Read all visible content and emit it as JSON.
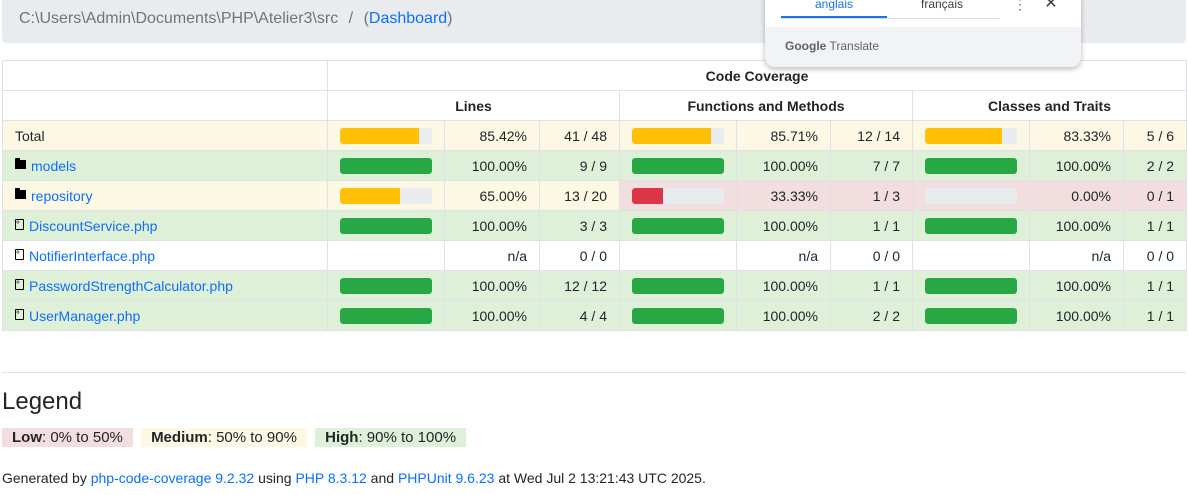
{
  "breadcrumb": {
    "path": "C:\\Users\\Admin\\Documents\\PHP\\Atelier3\\src",
    "separator": "/",
    "open_paren": "(",
    "dashboard_label": "Dashboard",
    "close_paren": ")"
  },
  "translate_popup": {
    "tab_active": "anglais",
    "tab_other": "français",
    "more": "⋮",
    "close": "✕",
    "brand_google": "Google",
    "brand_translate": "Translate"
  },
  "table": {
    "header_main": "Code Coverage",
    "group_lines": "Lines",
    "group_functions": "Functions and Methods",
    "group_classes": "Classes and Traits",
    "rows": [
      {
        "name": "Total",
        "kind": "total",
        "lines_pct": "85.42%",
        "lines_frac": "41 / 48",
        "lines_bar": 85.42,
        "func_pct": "85.71%",
        "func_frac": "12 / 14",
        "func_bar": 85.71,
        "cls_pct": "83.33%",
        "cls_frac": "5 / 6",
        "cls_bar": 83.33
      },
      {
        "name": "models",
        "kind": "folder",
        "lines_pct": "100.00%",
        "lines_frac": "9 / 9",
        "lines_bar": 100,
        "func_pct": "100.00%",
        "func_frac": "7 / 7",
        "func_bar": 100,
        "cls_pct": "100.00%",
        "cls_frac": "2 / 2",
        "cls_bar": 100
      },
      {
        "name": "repository",
        "kind": "folder",
        "lines_pct": "65.00%",
        "lines_frac": "13 / 20",
        "lines_bar": 65,
        "func_pct": "33.33%",
        "func_frac": "1 / 3",
        "func_bar": 33.33,
        "cls_pct": "0.00%",
        "cls_frac": "0 / 1",
        "cls_bar": 0
      },
      {
        "name": "DiscountService.php",
        "kind": "file",
        "lines_pct": "100.00%",
        "lines_frac": "3 / 3",
        "lines_bar": 100,
        "func_pct": "100.00%",
        "func_frac": "1 / 1",
        "func_bar": 100,
        "cls_pct": "100.00%",
        "cls_frac": "1 / 1",
        "cls_bar": 100
      },
      {
        "name": "NotifierInterface.php",
        "kind": "file",
        "lines_pct": "n/a",
        "lines_frac": "0 / 0",
        "lines_bar": null,
        "func_pct": "n/a",
        "func_frac": "0 / 0",
        "func_bar": null,
        "cls_pct": "n/a",
        "cls_frac": "0 / 0",
        "cls_bar": null
      },
      {
        "name": "PasswordStrengthCalculator.php",
        "kind": "file",
        "lines_pct": "100.00%",
        "lines_frac": "12 / 12",
        "lines_bar": 100,
        "func_pct": "100.00%",
        "func_frac": "1 / 1",
        "func_bar": 100,
        "cls_pct": "100.00%",
        "cls_frac": "1 / 1",
        "cls_bar": 100
      },
      {
        "name": "UserManager.php",
        "kind": "file",
        "lines_pct": "100.00%",
        "lines_frac": "4 / 4",
        "lines_bar": 100,
        "func_pct": "100.00%",
        "func_frac": "2 / 2",
        "func_bar": 100,
        "cls_pct": "100.00%",
        "cls_frac": "1 / 1",
        "cls_bar": 100
      }
    ]
  },
  "legend": {
    "title": "Legend",
    "low_label": "Low",
    "low_range": ": 0% to 50%",
    "medium_label": "Medium",
    "medium_range": ": 50% to 90%",
    "high_label": "High",
    "high_range": ": 90% to 100%"
  },
  "footer": {
    "prefix": "Generated by ",
    "tool_link": "php-code-coverage 9.2.32",
    "using": " using ",
    "php_link": "PHP 8.3.12",
    "and": " and ",
    "phpunit_link": "PHPUnit 9.6.23",
    "suffix": " at Wed Jul 2 13:21:43 UTC 2025."
  },
  "colors": {
    "success_bg": "#dff0d8",
    "warning_bg": "#fcf8e3",
    "danger_bg": "#f2dede",
    "bar_high": "#28a745",
    "bar_medium": "#ffc107",
    "bar_low": "#dc3545",
    "link": "#0d6efd"
  }
}
